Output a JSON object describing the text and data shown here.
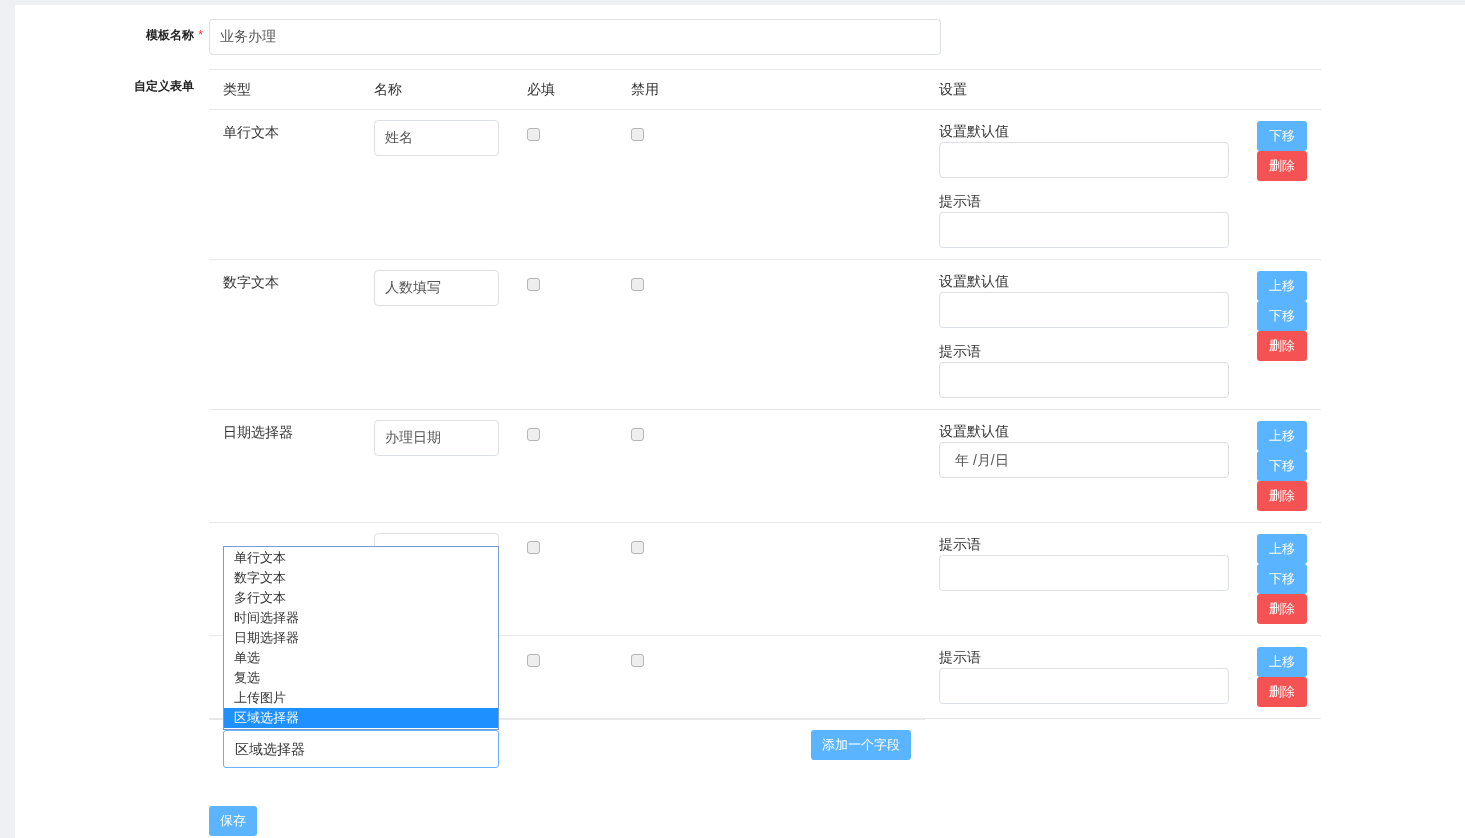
{
  "template_name": {
    "label": "模板名称",
    "required_mark": "*",
    "value": "业务办理"
  },
  "custom_form": {
    "label": "自定义表单",
    "columns": [
      "类型",
      "名称",
      "必填",
      "禁用",
      "设置"
    ],
    "rows": [
      {
        "type": "单行文本",
        "name": "姓名",
        "required": false,
        "disabled": false,
        "settings": [
          {
            "kind": "text",
            "label": "设置默认值"
          },
          {
            "kind": "text",
            "label": "提示语"
          }
        ],
        "buttons": [
          {
            "kind": "move",
            "label": "下移"
          },
          {
            "kind": "delete",
            "label": "删除"
          }
        ]
      },
      {
        "type": "数字文本",
        "name": "人数填写",
        "required": false,
        "disabled": false,
        "settings": [
          {
            "kind": "text",
            "label": "设置默认值"
          },
          {
            "kind": "text",
            "label": "提示语"
          }
        ],
        "buttons": [
          {
            "kind": "move",
            "label": "上移"
          },
          {
            "kind": "move",
            "label": "下移"
          },
          {
            "kind": "delete",
            "label": "删除"
          }
        ]
      },
      {
        "type": "日期选择器",
        "name": "办理日期",
        "required": false,
        "disabled": false,
        "settings": [
          {
            "kind": "date",
            "label": "设置默认值",
            "placeholder": "年 /月/日"
          }
        ],
        "buttons": [
          {
            "kind": "move",
            "label": "上移"
          },
          {
            "kind": "move",
            "label": "下移"
          },
          {
            "kind": "delete",
            "label": "删除"
          }
        ]
      },
      {
        "name_field": true,
        "required": false,
        "disabled": false,
        "settings": [
          {
            "kind": "text",
            "label": "提示语"
          }
        ],
        "buttons": [
          {
            "kind": "move",
            "label": "上移"
          },
          {
            "kind": "move",
            "label": "下移"
          },
          {
            "kind": "delete",
            "label": "删除"
          }
        ]
      },
      {
        "required": false,
        "disabled": false,
        "settings": [
          {
            "kind": "text",
            "label": "提示语"
          }
        ],
        "buttons": [
          {
            "kind": "move",
            "label": "上移"
          },
          {
            "kind": "delete",
            "label": "删除"
          }
        ]
      }
    ],
    "type_dropdown": {
      "options": [
        {
          "label": "单行文本",
          "selected": false
        },
        {
          "label": "数字文本",
          "selected": false
        },
        {
          "label": "多行文本",
          "selected": false
        },
        {
          "label": "时间选择器",
          "selected": false
        },
        {
          "label": "日期选择器",
          "selected": false
        },
        {
          "label": "单选",
          "selected": false
        },
        {
          "label": "复选",
          "selected": false
        },
        {
          "label": "上传图片",
          "selected": false
        },
        {
          "label": "区域选择器",
          "selected": true
        }
      ]
    },
    "type_select": {
      "value": "区域选择器"
    },
    "add_button": "添加一个字段"
  },
  "save_button": "保存"
}
